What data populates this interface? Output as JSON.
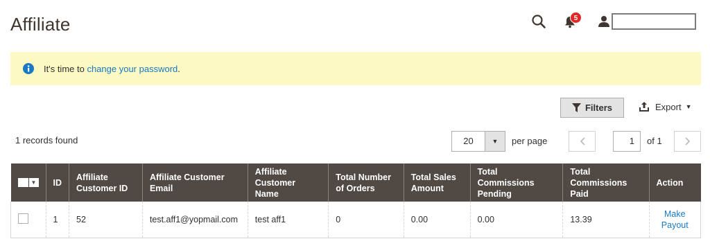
{
  "page": {
    "title": "Affiliate"
  },
  "header": {
    "notification_count": "5"
  },
  "notice": {
    "prefix": "It's time to ",
    "link_text": "change your password",
    "suffix": "."
  },
  "toolbar": {
    "filters_label": "Filters",
    "export_label": "Export"
  },
  "grid": {
    "records_found": "1 records found",
    "per_page_value": "20",
    "per_page_label": "per page",
    "current_page": "1",
    "of_pages": "of 1",
    "columns": [
      "ID",
      "Affiliate Customer ID",
      "Affiliate Customer Email",
      "Affiliate Customer Name",
      "Total Number of Orders",
      "Total Sales Amount",
      "Total Commissions Pending",
      "Total Commissions Paid",
      "Action"
    ],
    "rows": [
      {
        "id": "1",
        "customer_id": "52",
        "email": "test.aff1@yopmail.com",
        "name": "test aff1",
        "orders": "0",
        "sales": "0.00",
        "pending": "0.00",
        "paid": "13.39",
        "action": "Make Payout"
      }
    ]
  },
  "colors": {
    "header_bg": "#514943",
    "notice_bg": "#fdf9c2",
    "link": "#1979c3",
    "badge": "#e22626"
  }
}
